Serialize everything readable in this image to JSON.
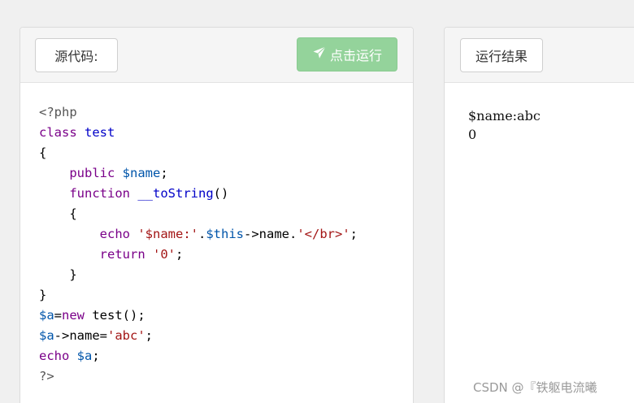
{
  "left_panel": {
    "source_button": "源代码:",
    "run_button": "点击运行",
    "code_lines": [
      [
        {
          "t": "<?php",
          "c": "tag"
        }
      ],
      [
        {
          "t": "class ",
          "c": "kw"
        },
        {
          "t": "test",
          "c": "cls"
        }
      ],
      [
        {
          "t": "{",
          "c": ""
        }
      ],
      [
        {
          "t": "    ",
          "c": ""
        },
        {
          "t": "public ",
          "c": "kw"
        },
        {
          "t": "$name",
          "c": "var"
        },
        {
          "t": ";",
          "c": ""
        }
      ],
      [
        {
          "t": "    ",
          "c": ""
        },
        {
          "t": "function ",
          "c": "kw"
        },
        {
          "t": "__toString",
          "c": "cls"
        },
        {
          "t": "()",
          "c": ""
        }
      ],
      [
        {
          "t": "    {",
          "c": ""
        }
      ],
      [
        {
          "t": "        ",
          "c": ""
        },
        {
          "t": "echo ",
          "c": "kw"
        },
        {
          "t": "'$name:'",
          "c": "str"
        },
        {
          "t": ".",
          "c": ""
        },
        {
          "t": "$this",
          "c": "var"
        },
        {
          "t": "->name.",
          "c": ""
        },
        {
          "t": "'</br>'",
          "c": "str"
        },
        {
          "t": ";",
          "c": ""
        }
      ],
      [
        {
          "t": "        ",
          "c": ""
        },
        {
          "t": "return ",
          "c": "kw"
        },
        {
          "t": "'0'",
          "c": "str"
        },
        {
          "t": ";",
          "c": ""
        }
      ],
      [
        {
          "t": "    }",
          "c": ""
        }
      ],
      [
        {
          "t": "}",
          "c": ""
        }
      ],
      [
        {
          "t": "$a",
          "c": "var"
        },
        {
          "t": "=",
          "c": ""
        },
        {
          "t": "new ",
          "c": "kw"
        },
        {
          "t": "test();",
          "c": ""
        }
      ],
      [
        {
          "t": "$a",
          "c": "var"
        },
        {
          "t": "->name=",
          "c": ""
        },
        {
          "t": "'abc'",
          "c": "str"
        },
        {
          "t": ";",
          "c": ""
        }
      ],
      [
        {
          "t": "echo ",
          "c": "kw"
        },
        {
          "t": "$a",
          "c": "var"
        },
        {
          "t": ";",
          "c": ""
        }
      ],
      [
        {
          "t": "?>",
          "c": "tag"
        }
      ]
    ]
  },
  "right_panel": {
    "result_button": "运行结果",
    "output_lines": [
      "$name:abc",
      "0"
    ]
  },
  "watermark": "CSDN @『铁躯电流曦",
  "colors": {
    "run_button_bg": "#94d39b",
    "keyword": "#7a0089",
    "variable": "#0055aa",
    "string": "#a31515"
  },
  "icons": {
    "run_icon": "paper-plane-icon"
  }
}
